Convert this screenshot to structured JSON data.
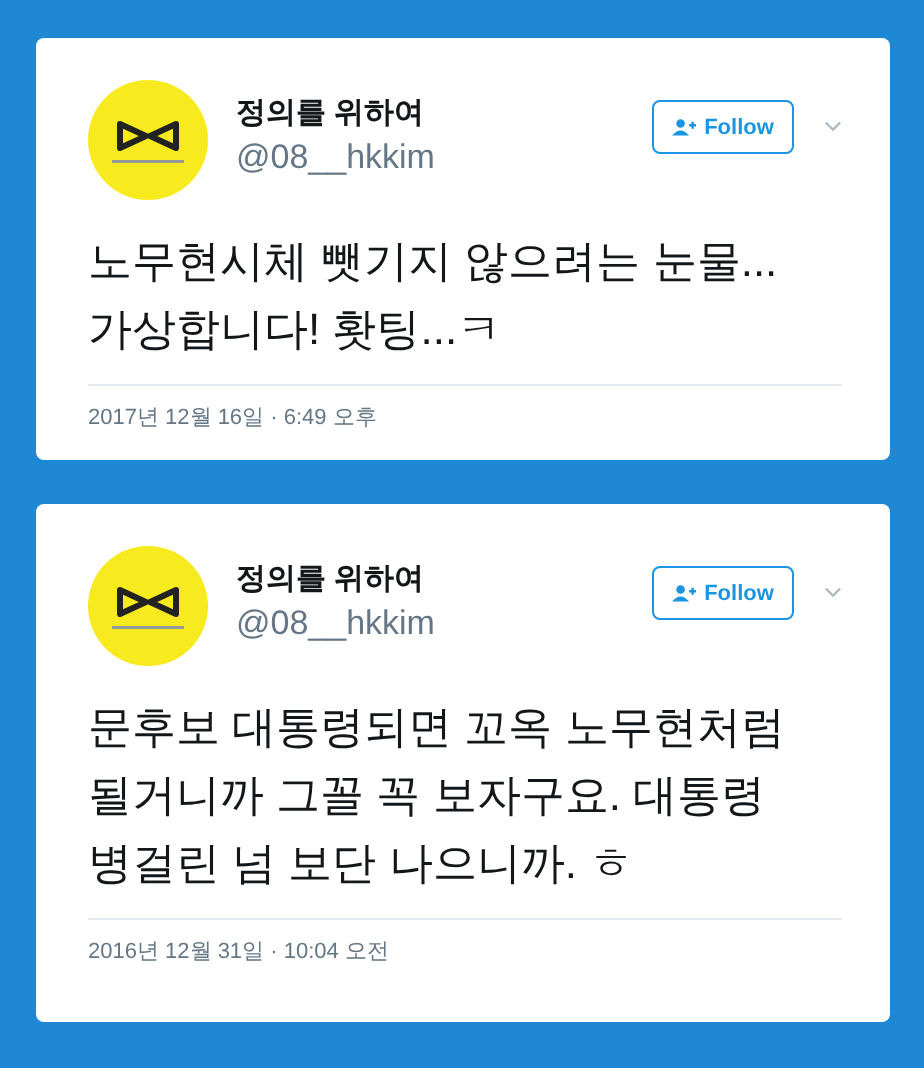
{
  "tweets": [
    {
      "name": "정의를 위하여",
      "handle": "@08__hkkim",
      "follow_label": "Follow",
      "text": "노무현시체 뺏기지 않으려는 눈물...\n가상합니다! 홧팅...ㅋ",
      "timestamp": "2017년 12월 16일 · 6:49 오후"
    },
    {
      "name": "정의를 위하여",
      "handle": "@08__hkkim",
      "follow_label": "Follow",
      "text": "문후보 대통령되면 꼬옥 노무현처럼\n될거니까 그꼴 꼭 보자구요. 대통령\n병걸린 넘 보단 나으니까. ㅎ",
      "timestamp": "2016년 12월 31일 · 10:04 오전"
    }
  ]
}
